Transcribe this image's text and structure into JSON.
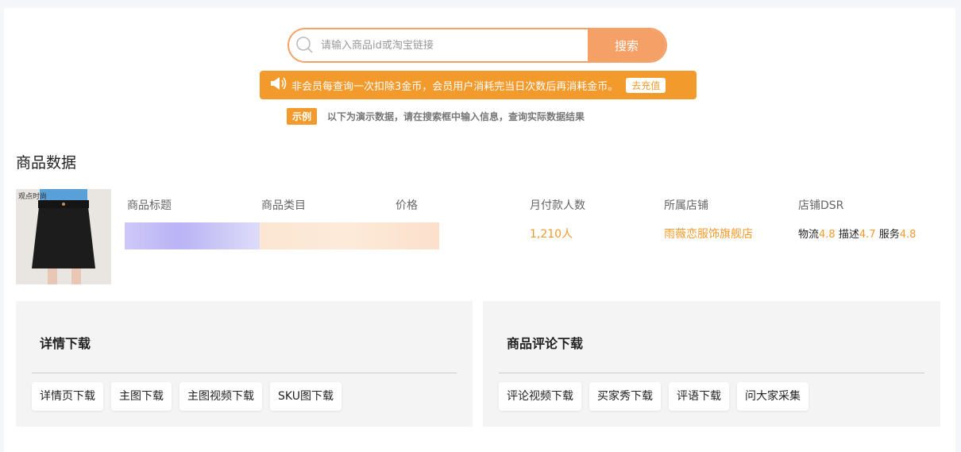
{
  "search": {
    "placeholder": "请输入商品id或淘宝链接",
    "button_label": "搜索"
  },
  "notice": {
    "message": "非会员每查询一次扣除3金币，会员用户消耗完当日次数后再消耗金币。",
    "recharge_label": "去充值"
  },
  "demo": {
    "tag": "示例",
    "text": "以下为演示数据，请在搜索框中输入信息，查询实际数据结果"
  },
  "section_title": "商品数据",
  "product": {
    "headers": [
      "商品标题",
      "商品类目",
      "价格",
      "月付款人数",
      "所属店铺",
      "店铺DSR"
    ],
    "monthly_buyers": "1,210人",
    "shop_name": "雨薇恋服饰旗舰店",
    "dsr": {
      "logistics_label": "物流",
      "logistics": "4.8",
      "desc_label": "描述",
      "desc": "4.7",
      "service_label": "服务",
      "service": "4.8"
    },
    "thumb_watermark": "观点时尚"
  },
  "panels": {
    "detail": {
      "title": "详情下载",
      "buttons": [
        "详情页下载",
        "主图下载",
        "主图视频下载",
        "SKU图下载"
      ]
    },
    "review": {
      "title": "商品评论下载",
      "buttons": [
        "评论视频下载",
        "买家秀下载",
        "评语下载",
        "问大家采集"
      ]
    }
  },
  "colors": {
    "accent": "#f39a2c",
    "search_border": "#f5a066"
  }
}
